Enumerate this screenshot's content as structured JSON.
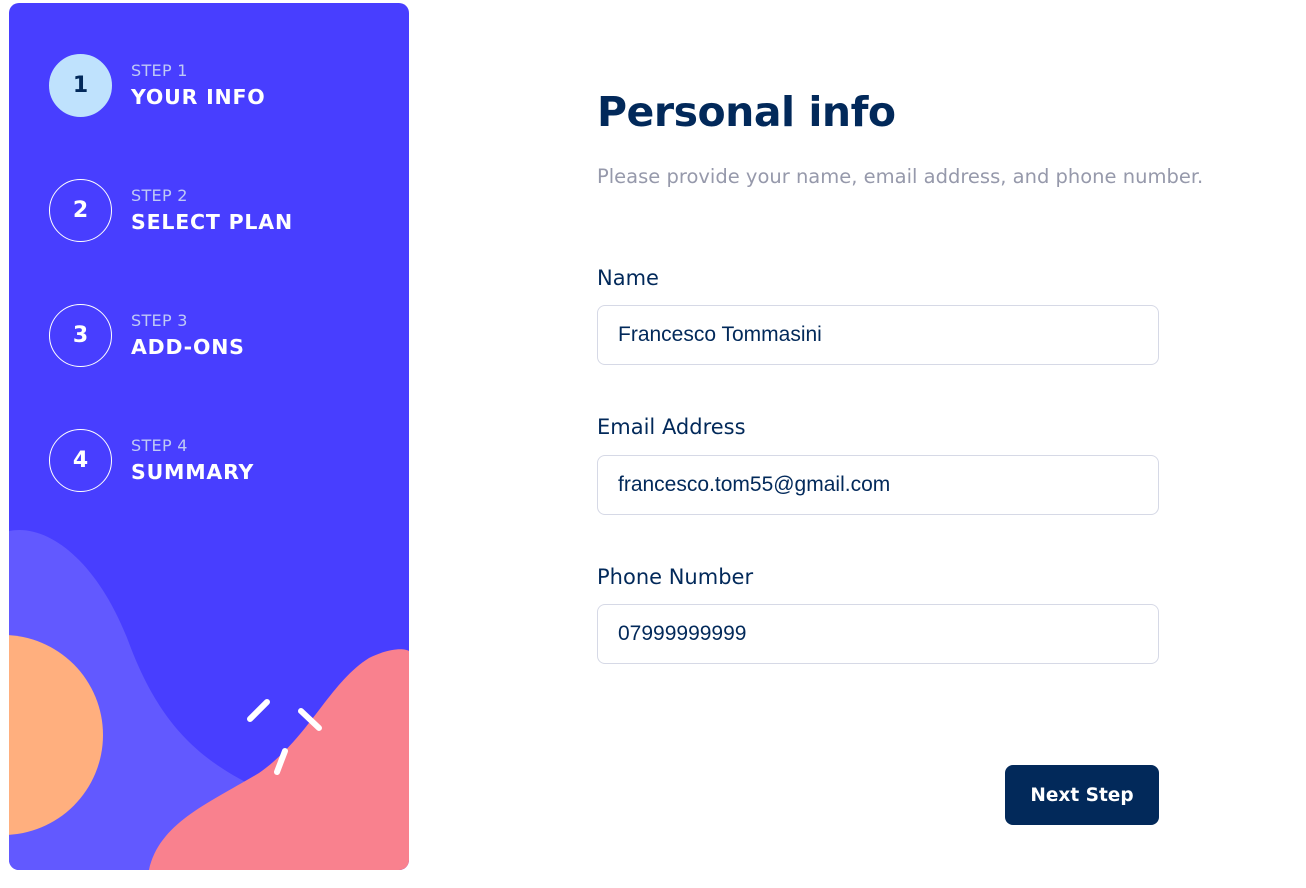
{
  "sidebar": {
    "steps": [
      {
        "number": "1",
        "kicker": "STEP 1",
        "title": "YOUR INFO",
        "active": true
      },
      {
        "number": "2",
        "kicker": "STEP 2",
        "title": "SELECT PLAN",
        "active": false
      },
      {
        "number": "3",
        "kicker": "STEP 3",
        "title": "ADD-ONS",
        "active": false
      },
      {
        "number": "4",
        "kicker": "STEP 4",
        "title": "SUMMARY",
        "active": false
      }
    ]
  },
  "main": {
    "title": "Personal info",
    "subtitle": "Please provide your name, email address, and phone number.",
    "fields": {
      "name": {
        "label": "Name",
        "value": "Francesco Tommasini"
      },
      "email": {
        "label": "Email Address",
        "value": "francesco.tom55@gmail.com"
      },
      "phone": {
        "label": "Phone Number",
        "value": "07999999999"
      }
    },
    "next_label": "Next Step"
  },
  "colors": {
    "sidebar_bg": "#483eff",
    "active_step_bg": "#bfe2fd",
    "marine_blue": "#02295a",
    "cool_gray": "#9699ab",
    "border": "#d6d9e6",
    "decor_orange": "#ffaf7e",
    "decor_pink": "#f9818e",
    "decor_purple": "#6259ff"
  }
}
